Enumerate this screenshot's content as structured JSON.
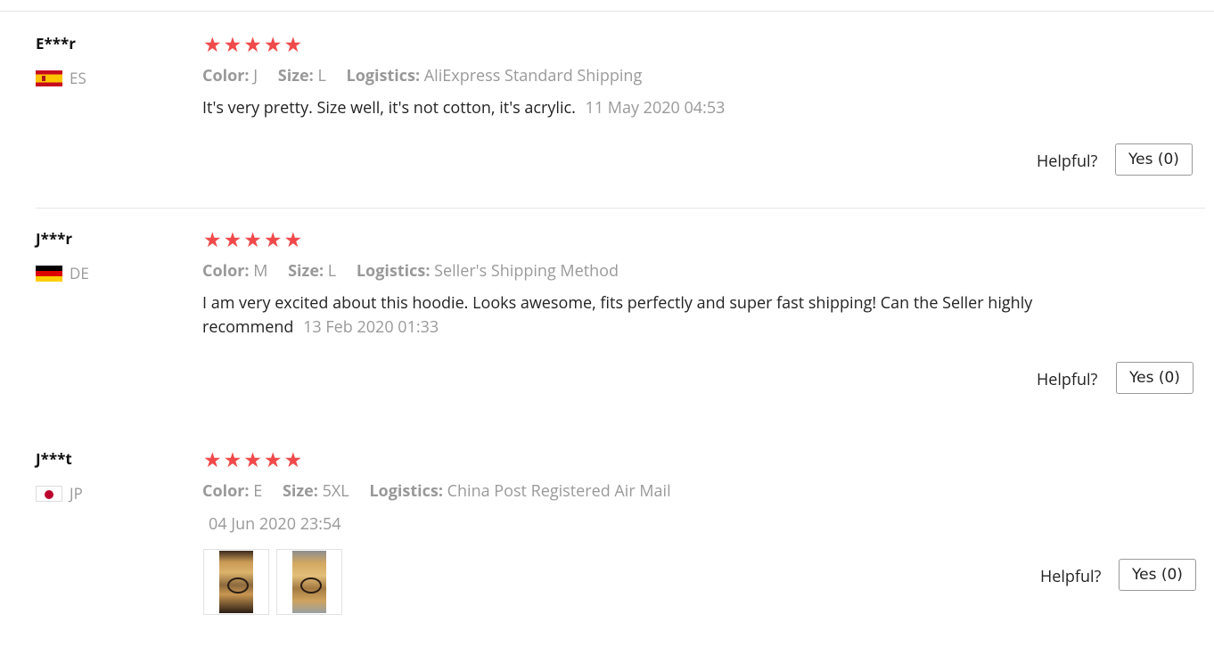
{
  "reviews": [
    {
      "user": "E***r",
      "country": "ES",
      "rating": 5,
      "color_label": "Color:",
      "color_value": "J",
      "size_label": "Size:",
      "size_value": "L",
      "logistics_label": "Logistics:",
      "logistics_value": "AliExpress Standard Shipping",
      "feedback": "It's very pretty. Size well, it's not cotton, it's acrylic.",
      "date": "11 May 2020 04:53",
      "helpful_label": "Helpful?",
      "yes_label": "Yes (0)"
    },
    {
      "user": "J***r",
      "country": "DE",
      "rating": 5,
      "color_label": "Color:",
      "color_value": "M",
      "size_label": "Size:",
      "size_value": "L",
      "logistics_label": "Logistics:",
      "logistics_value": "Seller's Shipping Method",
      "feedback": "I am very excited about this hoodie. Looks awesome, fits perfectly and super fast shipping! Can the Seller highly recommend",
      "date": "13 Feb 2020 01:33",
      "helpful_label": "Helpful?",
      "yes_label": "Yes (0)"
    },
    {
      "user": "J***t",
      "country": "JP",
      "rating": 5,
      "color_label": "Color:",
      "color_value": "E",
      "size_label": "Size:",
      "size_value": "5XL",
      "logistics_label": "Logistics:",
      "logistics_value": "China Post Registered Air Mail",
      "feedback": "",
      "date": "04 Jun 2020 23:54",
      "helpful_label": "Helpful?",
      "yes_label": "Yes (0)",
      "photos": [
        "review-photo-1",
        "review-photo-2"
      ]
    }
  ],
  "colors": {
    "star": "#f0494a",
    "muted_text": "#999999",
    "text": "#222222"
  },
  "icons": {
    "star": "star-icon"
  }
}
